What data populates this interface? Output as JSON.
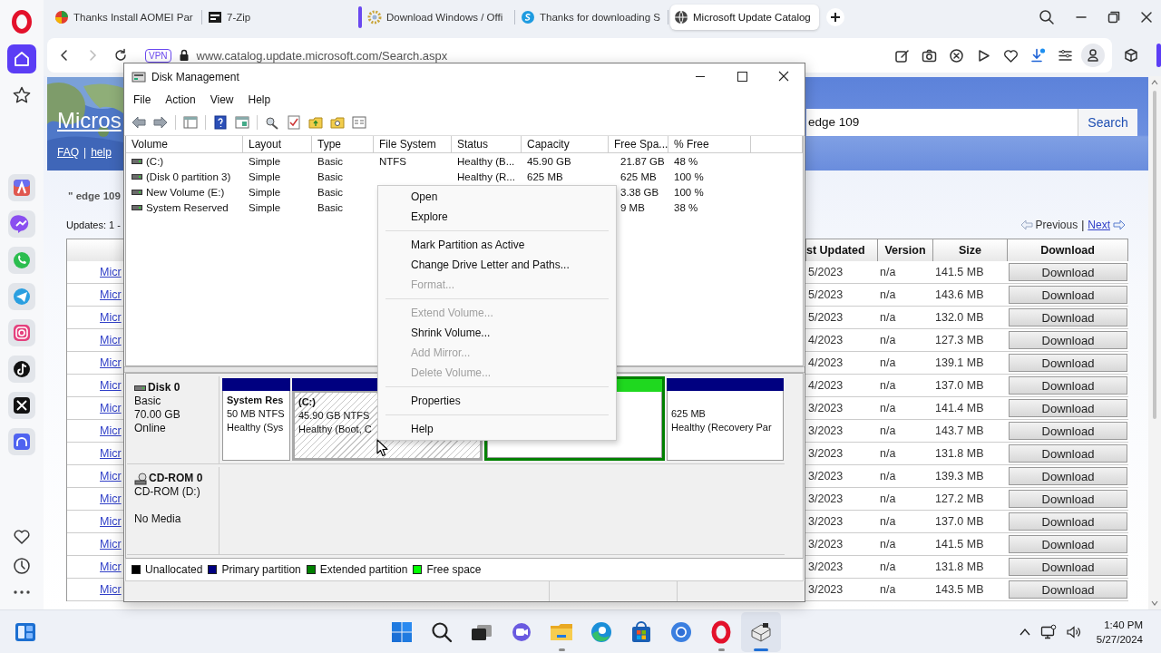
{
  "browser": {
    "tabs": [
      {
        "title": "Thanks Install AOMEI Par",
        "selected": false,
        "grouped": false
      },
      {
        "title": "7-Zip",
        "selected": false,
        "grouped": false
      },
      {
        "title": "Download Windows / Offi",
        "selected": false,
        "grouped": true
      },
      {
        "title": "Thanks for downloading S",
        "selected": false,
        "grouped": false
      },
      {
        "title": "Microsoft Update Catalog",
        "selected": true,
        "grouped": false
      }
    ],
    "address": {
      "badge": "VPN",
      "url": "www.catalog.update.microsoft.com/Search.aspx"
    }
  },
  "catalog": {
    "logo": "Micros",
    "nav": [
      "FAQ",
      "help"
    ],
    "nav_separator": "|",
    "search": {
      "value": "edge 109",
      "button": "Search"
    },
    "query": "\" edge 109",
    "results_count": "Updates: 1 -",
    "pager": {
      "previous": {
        "label": "Previous",
        "disabled": true
      },
      "separator": "|",
      "next": {
        "label": "Next",
        "disabled": false
      }
    },
    "columns": [
      "st Updated",
      "Version",
      "Size",
      "Download"
    ],
    "rows": [
      {
        "title": "Micr",
        "last_updated": "5/2023",
        "version": "n/a",
        "size": "141.5 MB",
        "download": "Download"
      },
      {
        "title": "Micr",
        "last_updated": "5/2023",
        "version": "n/a",
        "size": "143.6 MB",
        "download": "Download"
      },
      {
        "title": "Micr",
        "last_updated": "5/2023",
        "version": "n/a",
        "size": "132.0 MB",
        "download": "Download"
      },
      {
        "title": "Micr",
        "last_updated": "4/2023",
        "version": "n/a",
        "size": "127.3 MB",
        "download": "Download"
      },
      {
        "title": "Micr",
        "last_updated": "4/2023",
        "version": "n/a",
        "size": "139.1 MB",
        "download": "Download"
      },
      {
        "title": "Micr",
        "last_updated": "4/2023",
        "version": "n/a",
        "size": "137.0 MB",
        "download": "Download"
      },
      {
        "title": "Micr",
        "last_updated": "3/2023",
        "version": "n/a",
        "size": "141.4 MB",
        "download": "Download"
      },
      {
        "title": "Micr",
        "last_updated": "3/2023",
        "version": "n/a",
        "size": "143.7 MB",
        "download": "Download"
      },
      {
        "title": "Micr",
        "last_updated": "3/2023",
        "version": "n/a",
        "size": "131.8 MB",
        "download": "Download"
      },
      {
        "title": "Micr",
        "last_updated": "3/2023",
        "version": "n/a",
        "size": "139.3 MB",
        "download": "Download"
      },
      {
        "title": "Micr",
        "last_updated": "3/2023",
        "version": "n/a",
        "size": "127.2 MB",
        "download": "Download"
      },
      {
        "title": "Micr",
        "last_updated": "3/2023",
        "version": "n/a",
        "size": "137.0 MB",
        "download": "Download"
      },
      {
        "title": "Micr",
        "last_updated": "3/2023",
        "version": "n/a",
        "size": "141.5 MB",
        "download": "Download"
      },
      {
        "title": "Micr",
        "last_updated": "3/2023",
        "version": "n/a",
        "size": "131.8 MB",
        "download": "Download"
      },
      {
        "title": "Micr",
        "last_updated": "3/2023",
        "version": "n/a",
        "size": "143.5 MB",
        "download": "Download"
      }
    ]
  },
  "disk_management": {
    "title": "Disk Management",
    "menu": [
      "File",
      "Action",
      "View",
      "Help"
    ],
    "columns": [
      "Volume",
      "Layout",
      "Type",
      "File System",
      "Status",
      "Capacity",
      "Free Spa...",
      "% Free"
    ],
    "volumes": [
      {
        "volume": "(C:)",
        "layout": "Simple",
        "type": "Basic",
        "file_system": "NTFS",
        "status": "Healthy (B...",
        "capacity": "45.90 GB",
        "free_space": "21.87 GB",
        "percent_free": "48 %"
      },
      {
        "volume": "(Disk 0 partition 3)",
        "layout": "Simple",
        "type": "Basic",
        "status": "Healthy (R...",
        "capacity": "625 MB",
        "free_space": "625 MB",
        "percent_free": "100 %"
      },
      {
        "volume": "New Volume (E:)",
        "layout": "Simple",
        "type": "Basic",
        "free_space": "3.38 GB",
        "percent_free": "100 %"
      },
      {
        "volume": "System Reserved",
        "layout": "Simple",
        "type": "Basic",
        "free_space": "9 MB",
        "percent_free": "38 %"
      }
    ],
    "disks": [
      {
        "kind": "disk",
        "name": "Disk 0",
        "type": "Basic",
        "size": "70.00 GB",
        "status": "Online",
        "partitions": [
          {
            "kind": "primary",
            "selected": false,
            "name": "System Res",
            "size": "50 MB NTFS",
            "status": "Healthy (Sys"
          },
          {
            "kind": "primary",
            "selected": true,
            "name": "(C:)",
            "size": "45.90 GB NTFS",
            "status": "Healthy (Boot, C"
          },
          {
            "kind": "extended",
            "selected": false,
            "children": [
              {
                "kind": "free",
                "selected": false
              }
            ]
          },
          {
            "kind": "primary",
            "selected": false,
            "size": "625 MB",
            "status": "Healthy (Recovery Par"
          }
        ]
      },
      {
        "kind": "cdrom",
        "name": "CD-ROM 0",
        "type": "CD-ROM (D:)",
        "status": "No Media"
      }
    ],
    "legend": [
      {
        "label": "Unallocated",
        "color": "#000000"
      },
      {
        "label": "Primary partition",
        "color": "#000080"
      },
      {
        "label": "Extended partition",
        "color": "#008000"
      },
      {
        "label": "Free space",
        "color": "#00ff00"
      }
    ]
  },
  "context_menu": {
    "items": [
      {
        "kind": "item",
        "label": "Open",
        "disabled": false
      },
      {
        "kind": "item",
        "label": "Explore",
        "disabled": false
      },
      {
        "kind": "separator"
      },
      {
        "kind": "item",
        "label": "Mark Partition as Active",
        "disabled": false
      },
      {
        "kind": "item",
        "label": "Change Drive Letter and Paths...",
        "disabled": false
      },
      {
        "kind": "item",
        "label": "Format...",
        "disabled": true
      },
      {
        "kind": "separator"
      },
      {
        "kind": "item",
        "label": "Extend Volume...",
        "disabled": true
      },
      {
        "kind": "item",
        "label": "Shrink Volume...",
        "disabled": false
      },
      {
        "kind": "item",
        "label": "Add Mirror...",
        "disabled": true
      },
      {
        "kind": "item",
        "label": "Delete Volume...",
        "disabled": true
      },
      {
        "kind": "separator"
      },
      {
        "kind": "item",
        "label": "Properties",
        "disabled": false
      },
      {
        "kind": "separator"
      },
      {
        "kind": "item",
        "label": "Help",
        "disabled": false
      }
    ]
  },
  "taskbar": {
    "apps": [
      {
        "kind": "start",
        "running": false,
        "selected": false
      },
      {
        "kind": "search",
        "running": false,
        "selected": false
      },
      {
        "kind": "task-view",
        "running": false,
        "selected": false
      },
      {
        "kind": "video-chat",
        "running": false,
        "selected": false
      },
      {
        "kind": "folder",
        "running": true,
        "selected": false
      },
      {
        "kind": "swirl-browser",
        "running": false,
        "selected": false
      },
      {
        "kind": "store",
        "running": false,
        "selected": false
      },
      {
        "kind": "disc-browser",
        "running": false,
        "selected": false
      },
      {
        "kind": "ring-browser",
        "running": true,
        "selected": false
      },
      {
        "kind": "drive-tool",
        "running": true,
        "selected": true
      }
    ],
    "time": "1:40 PM",
    "date": "5/27/2024"
  }
}
